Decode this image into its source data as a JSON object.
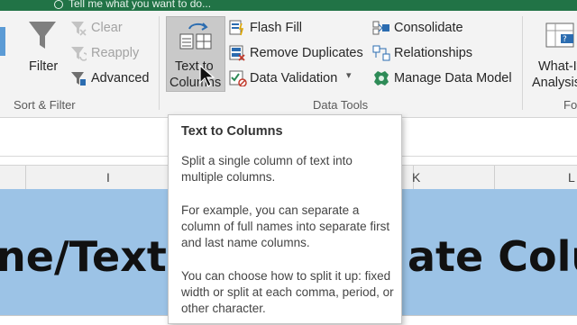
{
  "tell_me": "Tell me what you want to do...",
  "ribbon": {
    "sort_filter": {
      "filter_label": "Filter",
      "clear_label": "Clear",
      "reapply_label": "Reapply",
      "advanced_label": "Advanced",
      "group_label": "Sort & Filter"
    },
    "data_tools": {
      "text_to_columns_line1": "Text to",
      "text_to_columns_line2": "Columns",
      "flash_fill_label": "Flash Fill",
      "remove_duplicates_label": "Remove Duplicates",
      "data_validation_label": "Data Validation",
      "consolidate_label": "Consolidate",
      "relationships_label": "Relationships",
      "manage_data_model_label": "Manage Data Model",
      "group_label": "Data Tools"
    },
    "forecast": {
      "whatif_line1": "What-If",
      "whatif_line2": "Analysis",
      "group_label": "Fo"
    }
  },
  "columns": [
    "I",
    "K",
    "L"
  ],
  "sheet": {
    "left_text": "ne/Text",
    "right_text": "ate Colu"
  },
  "tooltip": {
    "title": "Text to Columns",
    "p1": "Split a single column of text into multiple columns.",
    "p2": "For example, you can separate a column of full names into separate first and last name columns.",
    "p3": "You can choose how to split it up: fixed width or split at each comma, period, or other character."
  },
  "colors": {
    "excel_green": "#217346",
    "ribbon_bg": "#f3f3f3",
    "sheet_fill": "#9cc3e6"
  }
}
